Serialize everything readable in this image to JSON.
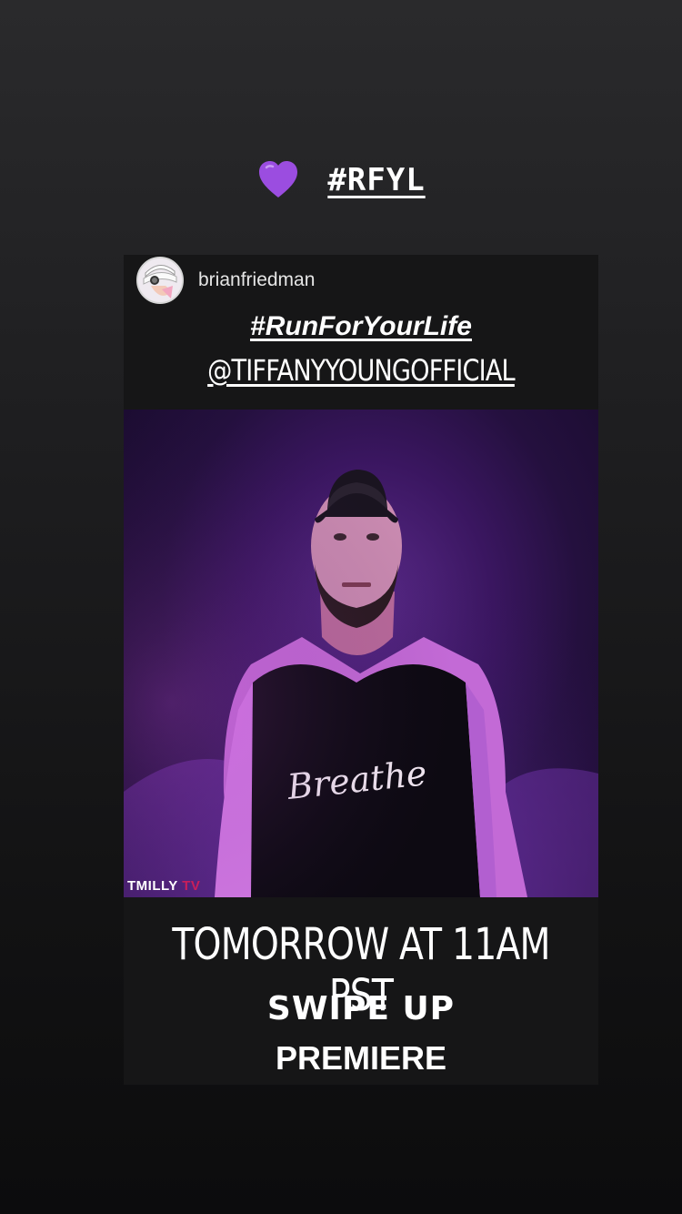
{
  "story_sticker": {
    "emoji": "💜",
    "hashtag": "#RFYL"
  },
  "post": {
    "username": "brianfriedman",
    "caption_hashtag": "#RunForYourLife",
    "caption_mention": "@TIFFANYYOUNGOFFICIAL",
    "image_alt": "Man in black bandana and black sleeveless shirt reading Breathe in purple light",
    "shirt_text": "Breathe",
    "watermark_main": "TMILLY",
    "watermark_tv": "TV",
    "premiere_time": "TOMORROW AT 11AM PST",
    "swipe_up": "SWIPE UP",
    "premiere_label": "PREMIERE"
  },
  "colors": {
    "heart": "#9b4de0",
    "image_bg": "#3a1660",
    "watermark_tv": "#c81e5a"
  }
}
